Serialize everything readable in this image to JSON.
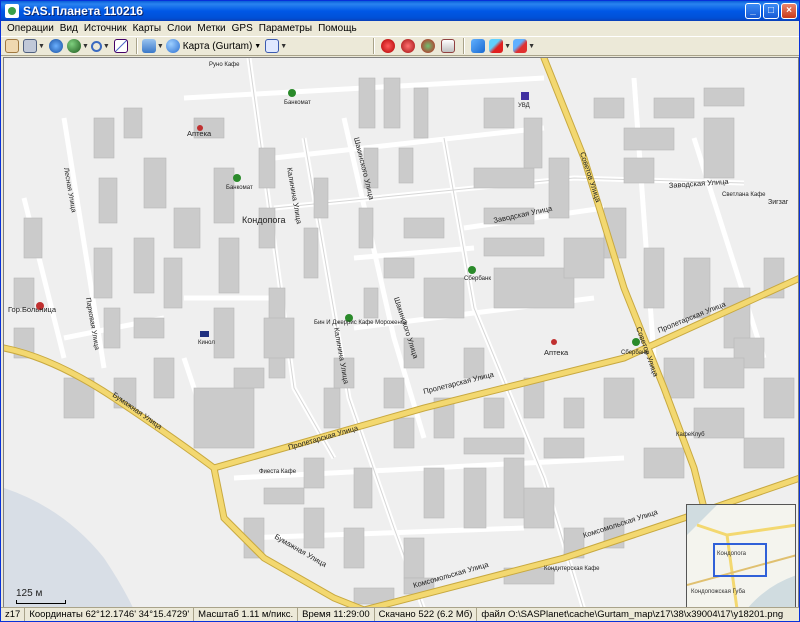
{
  "window": {
    "title": "SAS.Планета 110216"
  },
  "menu": [
    "Операции",
    "Вид",
    "Источник",
    "Карты",
    "Слои",
    "Метки",
    "GPS",
    "Параметры",
    "Помощь"
  ],
  "toolbar": {
    "map_selector": "Карта (Gurtam)"
  },
  "map": {
    "labels": {
      "kondopoga": "Кондопога",
      "proletarskaya_1": "Пролетарская Улица",
      "proletarskaya_2": "Пролетарская Улица",
      "proletarskaya_3": "Пролетарская Улица",
      "bumazhnaya_1": "Бумажная Улица",
      "bumazhnaya_2": "Бумажная Улица",
      "komsomolskaya": "Комсомольская Улица",
      "komsomolskaya_2": "Комсомольская Улица",
      "zavodskaya": "Заводская Улица",
      "zavodskaya_2": "Заводская Улица",
      "kalinina_1": "Калинина Улица",
      "kalinina_2": "Калинина Улица",
      "sovetov": "Советов Улица",
      "sovetov_2": "Советов Улица",
      "shakinskaya_1": "Шакинского Улица",
      "shakinskaya_2": "Шакинского Улица",
      "gor_bolnica": "Гор.Больница",
      "apteka_1": "Аптека",
      "apteka_2": "Аптека",
      "bankomat_1": "Банкомат",
      "bankomat_2": "Банкомат",
      "sberbank_1": "Сбербанк",
      "sberbank_2": "Сбербанк",
      "kino": "Кинол",
      "bin": "Бин И Джеррис Кафе Мороженое",
      "fiesta": "Фиеста Кафе",
      "konditer": "Кондитерская Кафе",
      "svetlana": "Светлана Кафе",
      "kafeklub": "КафеКлуб",
      "runo": "Руно Кафе",
      "uvd": "УВД",
      "zigzag": "Зигзаг",
      "lesnaya": "Лесная Улица",
      "parkovaya": "Парковая Улица"
    },
    "scale_label": "125 м",
    "minimap": {
      "label1": "Кондопога",
      "label2": "Кондопожская Губа"
    }
  },
  "status": {
    "zoom": "z17",
    "coords": "Координаты 62°12.1746' 34°15.4729'",
    "scale": "Масштаб 1.11 м/пикс.",
    "time": "Время 11:29:00",
    "downloaded": "Скачано 522 (6.2 Мб)",
    "file": "файл O:\\SASPlanet\\cache\\Gurtam_map\\z17\\38\\x39004\\17\\y18201.png"
  },
  "colors": {
    "road_major": "#f3d870",
    "road_major_edge": "#c8a940",
    "building": "#cbcbcb",
    "ground": "#efefef",
    "water": "#d8dee6"
  }
}
